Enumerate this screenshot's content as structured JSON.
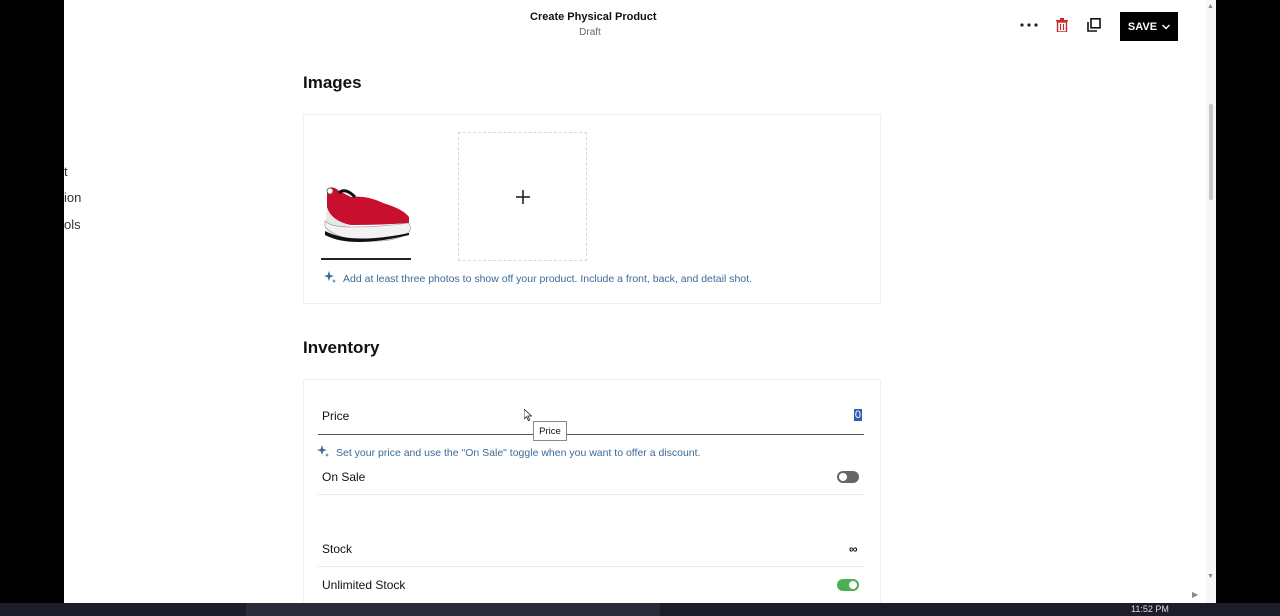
{
  "header": {
    "title": "Create Physical Product",
    "status": "Draft",
    "save_label": "SAVE",
    "more_icon": "more-horizontal-icon",
    "delete_icon": "trash-icon",
    "duplicate_icon": "duplicate-icon"
  },
  "sidebar_fragments": [
    "t",
    "ion",
    "ols"
  ],
  "images": {
    "title": "Images",
    "hint": "Add at least three photos to show off your product. Include a front, back, and detail shot."
  },
  "inventory": {
    "title": "Inventory",
    "price_label": "Price",
    "price_value": "0",
    "price_tooltip": "Price",
    "price_hint": "Set your price and use the \"On Sale\" toggle when you want to offer a discount.",
    "on_sale_label": "On Sale",
    "on_sale": false,
    "stock_label": "Stock",
    "stock_value": "∞",
    "unlimited_label": "Unlimited Stock",
    "unlimited": true
  },
  "taskbar": {
    "time": "11:52 PM"
  },
  "colors": {
    "accent_toggle_on": "#4caf50",
    "hint_text": "#3b6b9a",
    "delete_icon": "#c62828"
  }
}
